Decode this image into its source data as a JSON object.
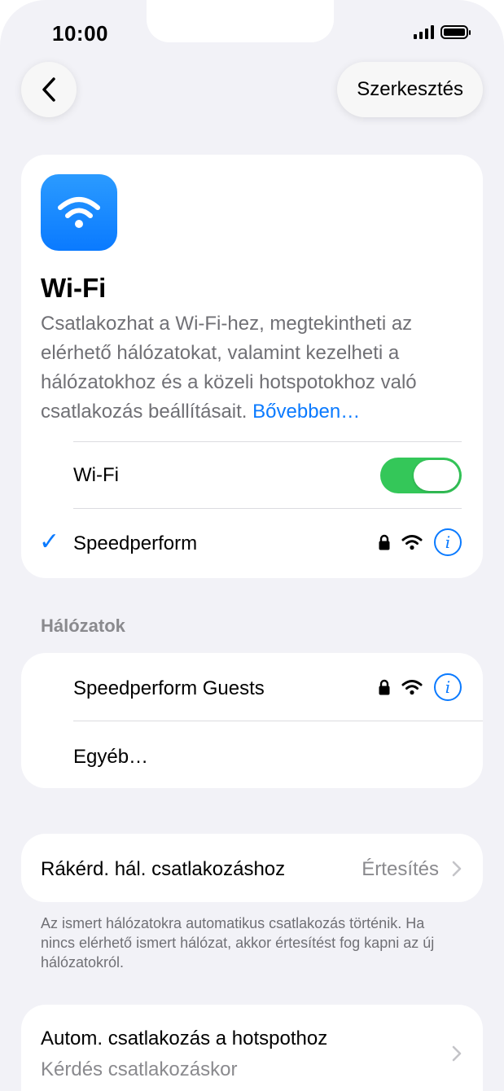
{
  "status": {
    "time": "10:00"
  },
  "nav": {
    "edit_label": "Szerkesztés"
  },
  "header": {
    "title": "Wi-Fi",
    "description": "Csatlakozhat a Wi-Fi-hez, megtekintheti az elérhető hálózatokat, valamint kezelheti a hálózatokhoz és a közeli hotspotokhoz való csatlakozás beállításait.",
    "learn_more": "Bővebben…"
  },
  "wifi_toggle": {
    "label": "Wi-Fi",
    "on": true
  },
  "connected": {
    "name": "Speedperform",
    "secured": true
  },
  "networks": {
    "header": "Hálózatok",
    "items": [
      {
        "name": "Speedperform Guests",
        "secured": true
      }
    ],
    "other_label": "Egyéb…"
  },
  "ask_join": {
    "label": "Rákérd. hál. csatlakozáshoz",
    "value": "Értesítés",
    "footer": "Az ismert hálózatokra automatikus csatlakozás történik. Ha nincs elérhető ismert hálózat, akkor értesítést fog kapni az új hálózatokról."
  },
  "auto_join": {
    "label": "Autom. csatlakozás a hotspothoz",
    "value": "Kérdés csatlakozáskor"
  },
  "colors": {
    "accent": "#0a7aff",
    "toggle_on": "#34c759",
    "background": "#f2f2f7"
  }
}
